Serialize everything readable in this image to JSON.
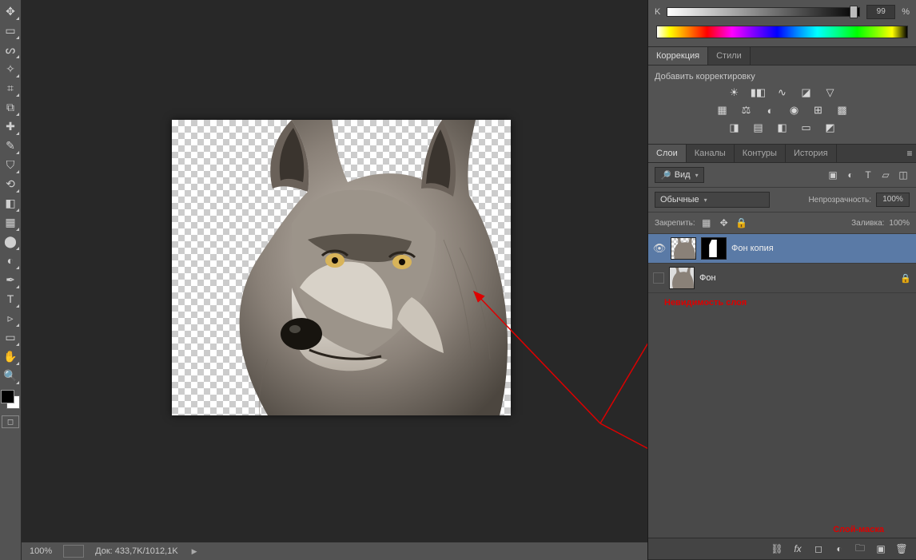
{
  "color": {
    "channel": "K",
    "value": "99",
    "percent": "%"
  },
  "corrections": {
    "tab_corrections": "Коррекция",
    "tab_styles": "Стили",
    "add_label": "Добавить корректировку"
  },
  "layers_panel": {
    "tab_layers": "Слои",
    "tab_channels": "Каналы",
    "tab_paths": "Контуры",
    "tab_history": "История",
    "filter_kind": "Вид",
    "blend_mode": "Обычные",
    "opacity_label": "Непрозрачность:",
    "opacity_value": "100%",
    "lock_label": "Закрепить:",
    "fill_label": "Заливка:",
    "fill_value": "100%",
    "layers": [
      {
        "name": "Фон копия",
        "visible": true,
        "selected": true,
        "has_mask": true,
        "locked": false
      },
      {
        "name": "Фон",
        "visible": false,
        "selected": false,
        "has_mask": false,
        "locked": true
      }
    ]
  },
  "annotations": {
    "layer_hidden": "Невидимость слоя",
    "layer_mask": "Слой-маска"
  },
  "status": {
    "zoom": "100%",
    "doc_info": "Док: 433,7K/1012,1K"
  },
  "search_placeholder": "Вид"
}
